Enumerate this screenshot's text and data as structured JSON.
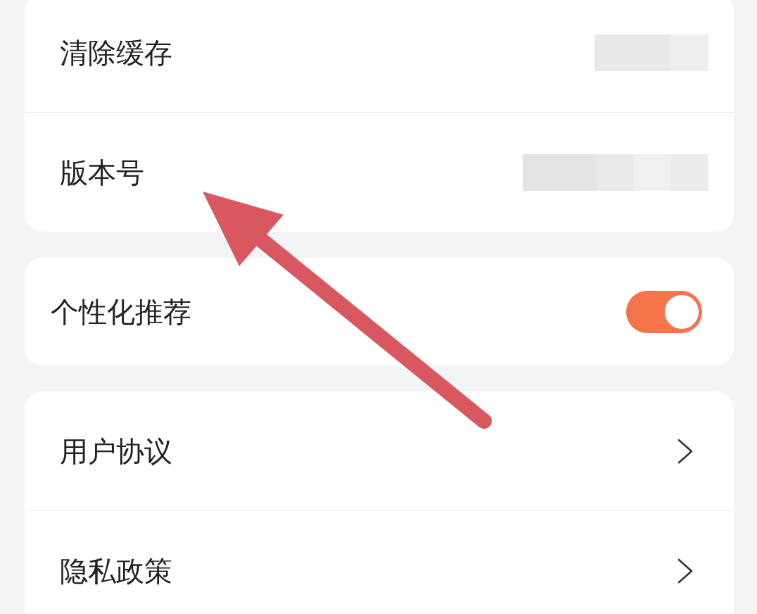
{
  "groups": [
    {
      "rows": [
        {
          "label": "清除缓存",
          "kind": "redacted"
        },
        {
          "label": "版本号",
          "kind": "redacted"
        }
      ]
    },
    {
      "rows": [
        {
          "label": "个性化推荐",
          "kind": "toggle",
          "on": true
        }
      ]
    },
    {
      "rows": [
        {
          "label": "用户协议",
          "kind": "link"
        },
        {
          "label": "隐私政策",
          "kind": "link"
        }
      ]
    }
  ]
}
